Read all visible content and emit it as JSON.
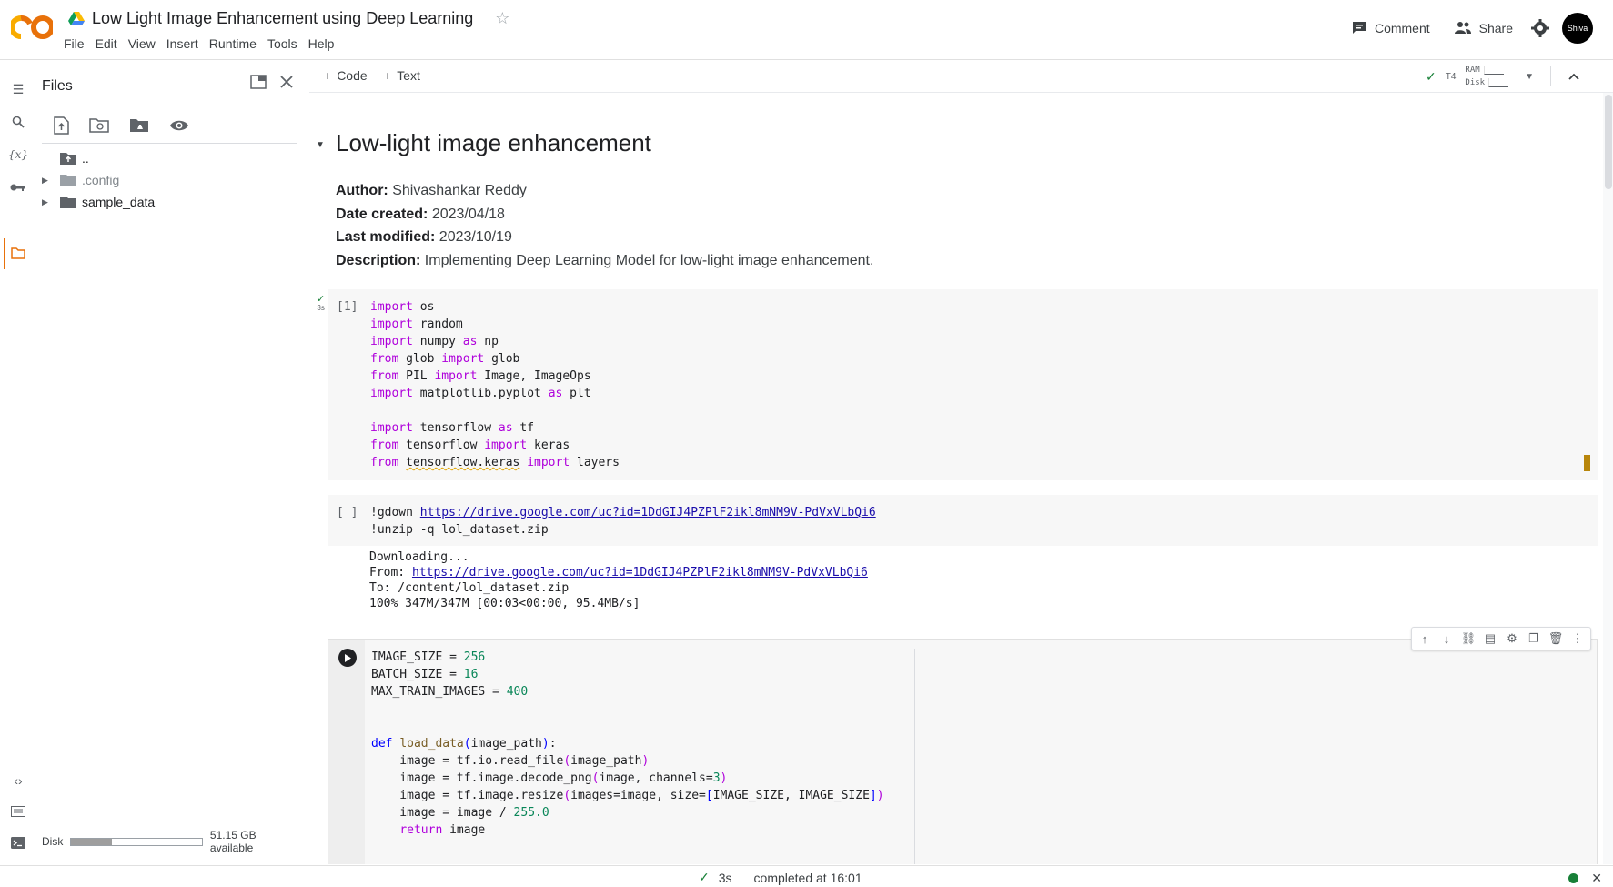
{
  "header": {
    "title": "Low Light Image Enhancement using Deep Learning",
    "menu": [
      "File",
      "Edit",
      "View",
      "Insert",
      "Runtime",
      "Tools",
      "Help"
    ],
    "comment_label": "Comment",
    "share_label": "Share",
    "avatar_text": "Shiva"
  },
  "files_panel": {
    "title": "Files",
    "tree": [
      {
        "label": ".."
      },
      {
        "label": ".config"
      },
      {
        "label": "sample_data"
      }
    ],
    "disk_label": "Disk",
    "disk_available": "51.15 GB available",
    "disk_used_fraction": 0.31
  },
  "toolbar": {
    "add_code": "Code",
    "add_text": "Text",
    "runtime_type": "T4",
    "ram_label": "RAM",
    "disk_label": "Disk"
  },
  "notebook": {
    "section_title": "Low-light image enhancement",
    "meta": [
      {
        "key": "Author:",
        "value": "Shivashankar Reddy"
      },
      {
        "key": "Date created:",
        "value": "2023/04/18"
      },
      {
        "key": "Last modified:",
        "value": "2023/10/19"
      },
      {
        "key": "Description:",
        "value": "Implementing Deep Learning Model for low-light image enhancement."
      }
    ],
    "cell1": {
      "prompt": "[1]",
      "exec_time": "3s"
    },
    "cell2": {
      "prompt": "[ ]",
      "gdown_cmd": "!gdown",
      "gdown_url": "https://drive.google.com/uc?id=1DdGIJ4PZPlF2ikl8mNM9V-PdVxVLbQi6",
      "unzip_cmd": "!unzip -q lol_dataset.zip",
      "output_downloading": "Downloading...",
      "output_from_label": "From:",
      "output_url": "https://drive.google.com/uc?id=1DdGIJ4PZPlF2ikl8mNM9V-PdVxVLbQi6",
      "output_to": "To: /content/lol_dataset.zip",
      "output_progress": "100% 347M/347M [00:03<00:00, 95.4MB/s]"
    }
  },
  "status": {
    "exec_time": "3s",
    "completed": "completed at 16:01"
  }
}
